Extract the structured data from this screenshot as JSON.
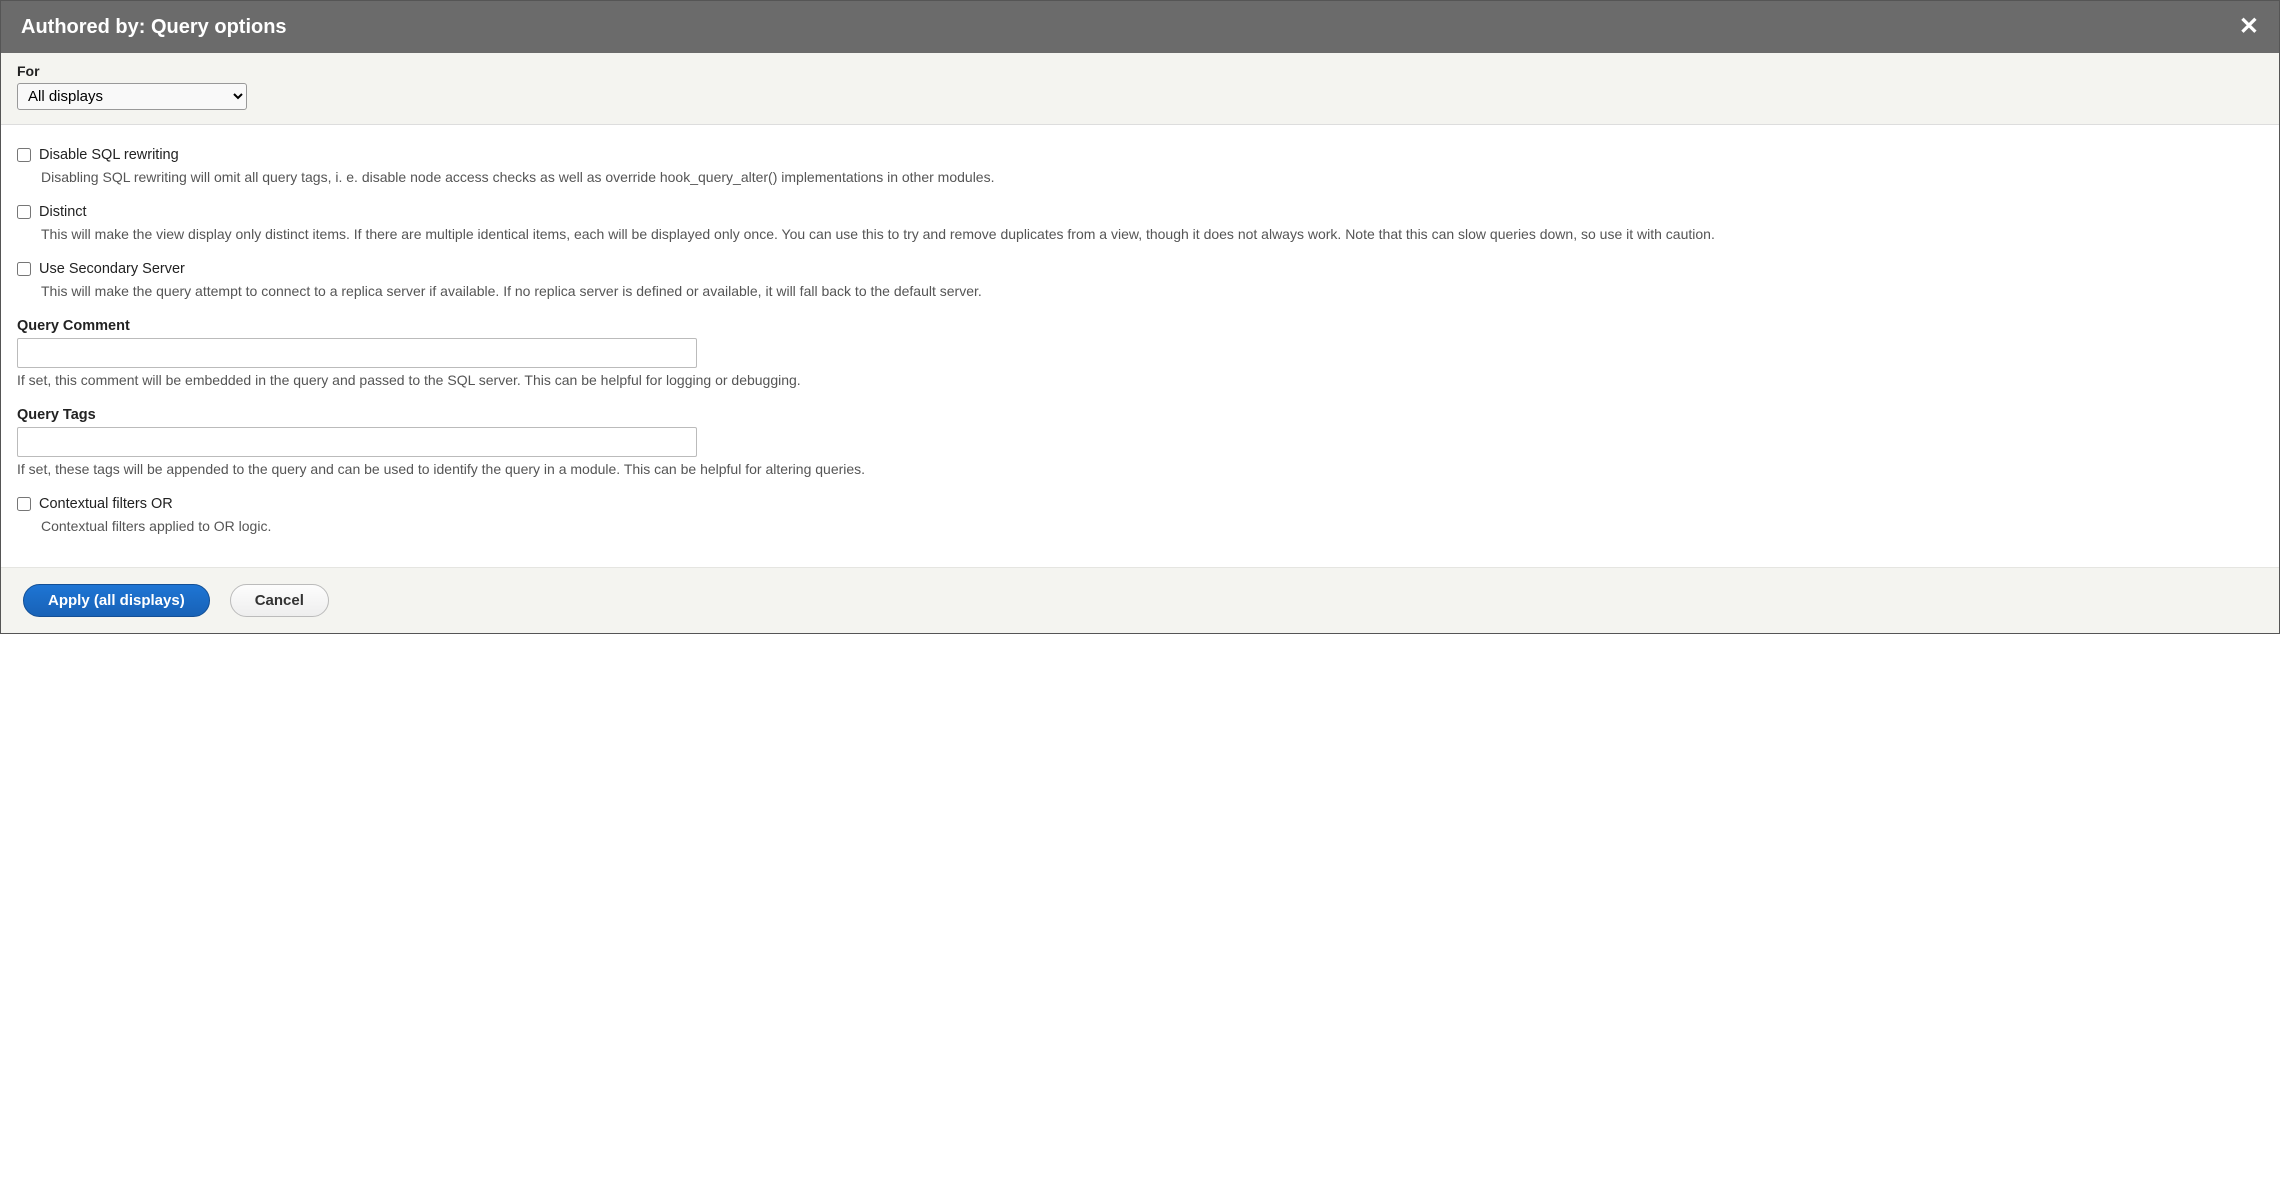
{
  "title": "Authored by: Query options",
  "close_glyph": "✕",
  "for": {
    "label": "For",
    "selected": "All displays"
  },
  "options": {
    "disable_sql": {
      "label": "Disable SQL rewriting",
      "description": "Disabling SQL rewriting will omit all query tags, i. e. disable node access checks as well as override hook_query_alter() implementations in other modules."
    },
    "distinct": {
      "label": "Distinct",
      "description": "This will make the view display only distinct items. If there are multiple identical items, each will be displayed only once. You can use this to try and remove duplicates from a view, though it does not always work. Note that this can slow queries down, so use it with caution."
    },
    "secondary": {
      "label": "Use Secondary Server",
      "description": "This will make the query attempt to connect to a replica server if available. If no replica server is defined or available, it will fall back to the default server."
    },
    "query_comment": {
      "label": "Query Comment",
      "value": "",
      "description": "If set, this comment will be embedded in the query and passed to the SQL server. This can be helpful for logging or debugging."
    },
    "query_tags": {
      "label": "Query Tags",
      "value": "",
      "description": "If set, these tags will be appended to the query and can be used to identify the query in a module. This can be helpful for altering queries."
    },
    "contextual": {
      "label": "Contextual filters OR",
      "description": "Contextual filters applied to OR logic."
    }
  },
  "actions": {
    "apply": "Apply (all displays)",
    "cancel": "Cancel"
  }
}
